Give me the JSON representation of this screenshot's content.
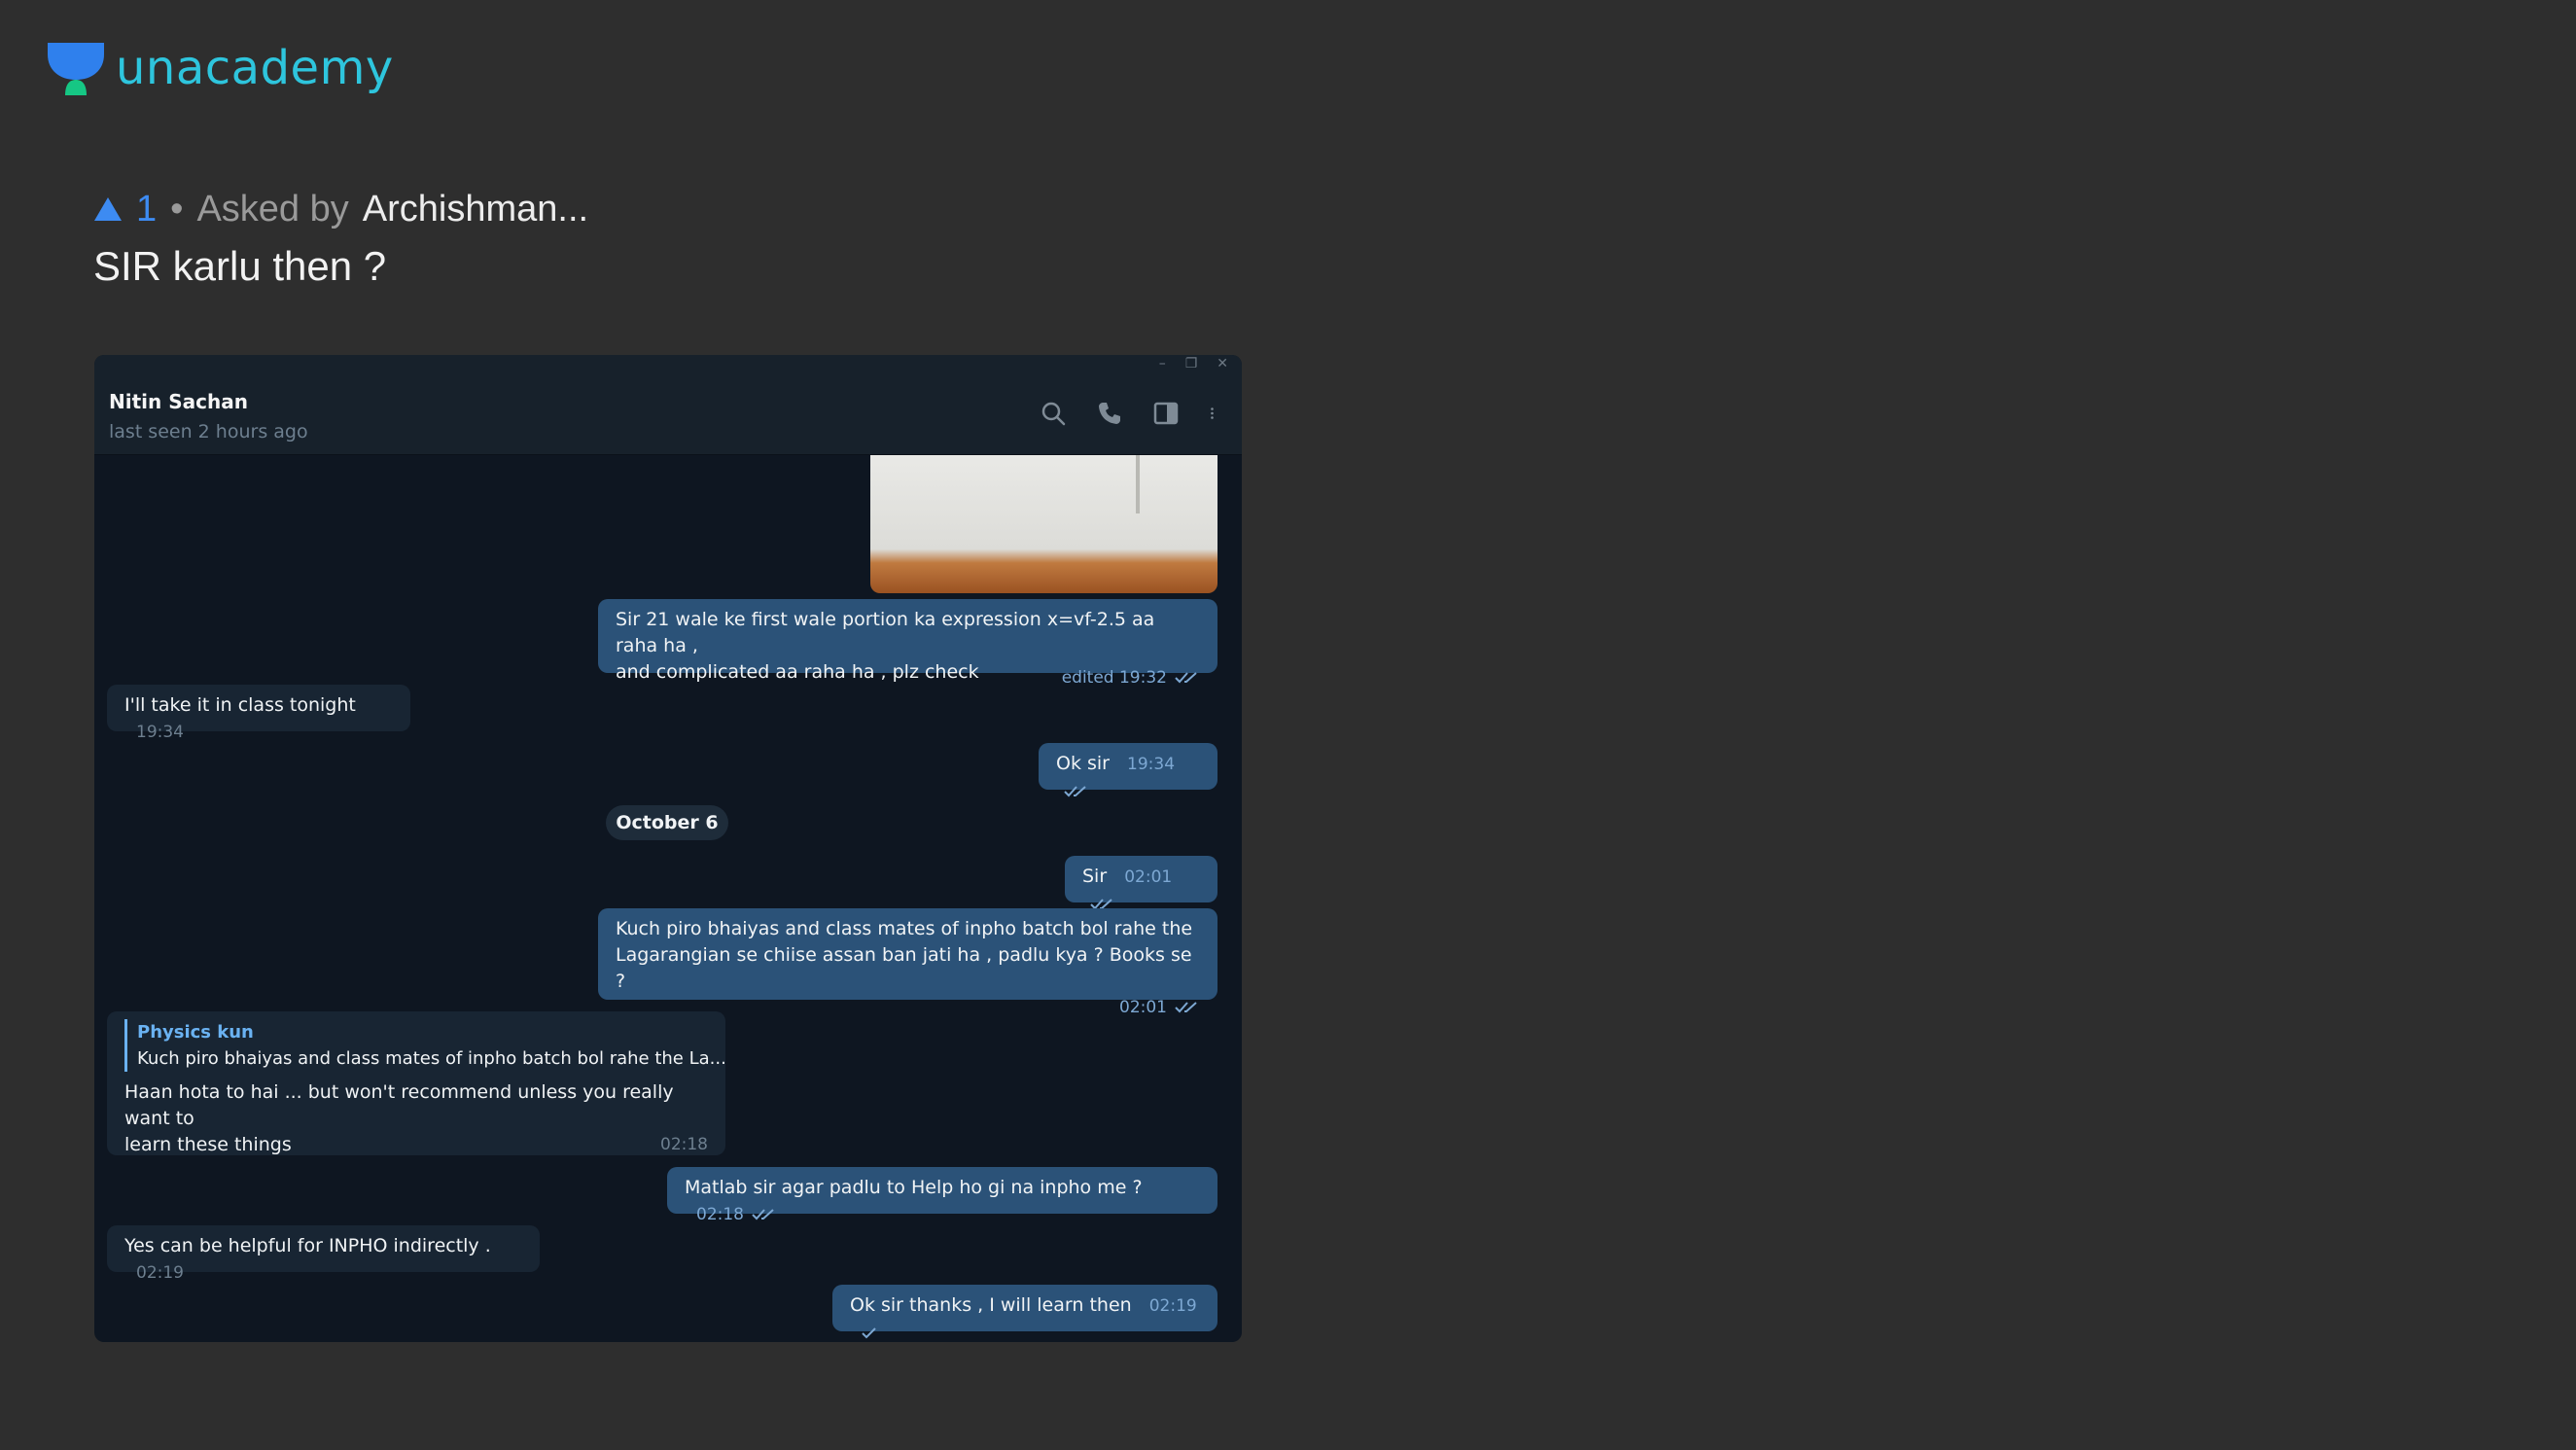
{
  "brand": {
    "name": "unacademy",
    "color": "#2ec5dd"
  },
  "question": {
    "upvotes": "1",
    "separator": "•",
    "asked_by_prefix": "Asked by",
    "asker": "Archishman...",
    "title": "SIR karlu then ?"
  },
  "chat": {
    "window_controls": [
      "–",
      "❐",
      "✕"
    ],
    "contact_name": "Nitin Sachan",
    "last_seen": "last seen 2 hours ago",
    "header_icons": [
      "search-icon",
      "phone-icon",
      "sidebar-icon",
      "more-icon"
    ],
    "messages": [
      {
        "dir": "out",
        "lines": [
          "Sir 21 wale ke first wale portion ka expression x=vf-2.5 aa raha ha ,",
          "and complicated aa raha ha , plz check"
        ],
        "time": "edited 19:32",
        "ticks": "double"
      },
      {
        "dir": "in",
        "text": "I'll take it in class tonight",
        "time": "19:34"
      },
      {
        "dir": "out",
        "text": "Ok sir",
        "time": "19:34",
        "ticks": "double"
      },
      {
        "dir": "out",
        "text": "Sir",
        "time": "02:01",
        "ticks": "double"
      },
      {
        "dir": "out",
        "lines": [
          "Kuch piro bhaiyas and class mates of inpho batch bol rahe the",
          "Lagarangian se chiise  assan  ban jati ha , padlu kya ? Books se ?"
        ],
        "time": "02:01",
        "ticks": "double"
      },
      {
        "dir": "in",
        "reply_name": "Physics kun",
        "reply_text": "Kuch piro bhaiyas and class mates of inpho batch bol rahe the La...",
        "lines": [
          "Haan hota to hai ... but won't recommend unless you really want to",
          "learn these things"
        ],
        "time": "02:18"
      },
      {
        "dir": "out",
        "text": "Matlab sir agar padlu to Help ho gi na inpho me ?",
        "time": "02:18",
        "ticks": "double"
      },
      {
        "dir": "in",
        "text": "Yes can be helpful for INPHO indirectly .",
        "time": "02:19"
      },
      {
        "dir": "out",
        "text": "Ok sir thanks , I will learn then",
        "time": "02:19",
        "ticks": "single"
      }
    ],
    "date_separator": "October 6",
    "colors": {
      "background": "#0e1621",
      "outgoing": "#2b5278",
      "incoming": "#182533",
      "accent": "#6ab2f2"
    }
  }
}
